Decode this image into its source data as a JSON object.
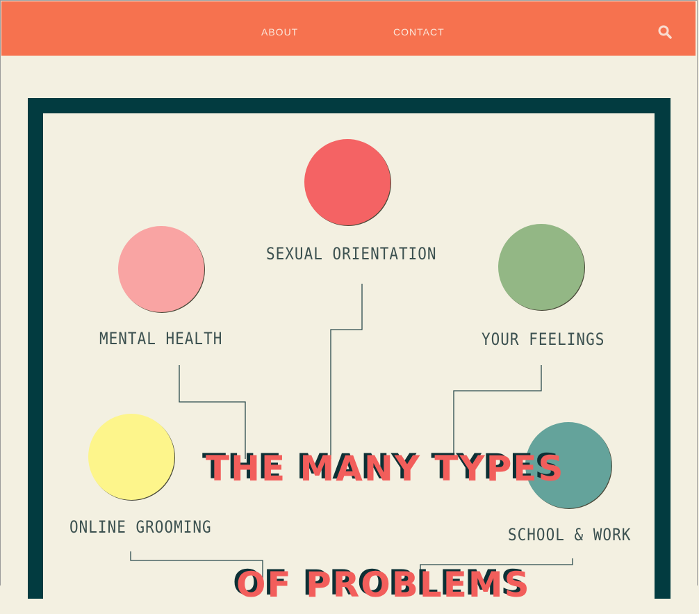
{
  "nav": {
    "about": "ABOUT",
    "contact": "CONTACT",
    "search_icon": "search-icon"
  },
  "colors": {
    "nav_bg": "#f6724f",
    "frame": "#023b40",
    "paper": "#f3f0e1",
    "headline": "#f25e5b",
    "headline_shadow": "#0d3035"
  },
  "poster": {
    "topics": [
      {
        "label": "SEXUAL ORIENTATION",
        "color": "#f46364"
      },
      {
        "label": "MENTAL HEALTH",
        "color": "#f9a4a3"
      },
      {
        "label": "YOUR FEELINGS",
        "color": "#93b785"
      },
      {
        "label": "ONLINE GROOMING",
        "color": "#fdf58b"
      },
      {
        "label": "SCHOOL & WORK",
        "color": "#64a39b"
      }
    ],
    "headline_line1": "THE MANY TYPES",
    "headline_line2": "OF PROBLEMS"
  }
}
